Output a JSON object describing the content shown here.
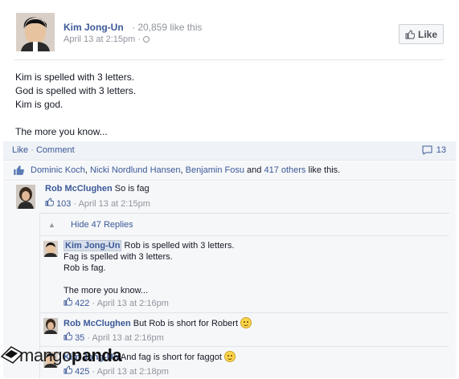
{
  "post": {
    "author": "Kim Jong-Un",
    "likes_text": "· 20,859 like this",
    "timestamp": "April 13 at 2:15pm ·",
    "like_button": "Like",
    "body_lines": [
      "Kim is spelled with 3 letters.",
      "God is spelled with 3 letters.",
      "Kim is god.",
      "",
      "The more you know..."
    ],
    "actions": {
      "like": "Like",
      "sep": "·",
      "comment": "Comment",
      "comment_count": "13"
    },
    "liked_by": {
      "names": [
        "Dominic Koch",
        "Nicki Nordlund Hansen",
        "Benjamin Fosu"
      ],
      "sep1": ", ",
      "and": " and ",
      "others": "417 others",
      "suffix": " like this."
    }
  },
  "comment": {
    "author": "Rob McClughen",
    "text": "So is fag",
    "likes": "103",
    "timestamp": "· April 13 at 2:15pm",
    "hide_replies": "Hide 47 Replies",
    "replies": [
      {
        "author": "Kim Jong-Un",
        "lines": [
          "Rob is spelled with 3 letters.",
          "Fag is spelled with 3 letters.",
          "Rob is fag.",
          "",
          "The more you know..."
        ],
        "likes": "422",
        "timestamp": "· April 13 at 2:16pm"
      },
      {
        "author": "Rob McClughen",
        "text": "But Rob is short for Robert",
        "likes": "35",
        "timestamp": "· April 13 at 2:16pm"
      },
      {
        "author": "Kim Jong-Un",
        "text": "And fag is short for faggot",
        "likes": "425",
        "timestamp": "· April 13 at 2:18pm"
      }
    ]
  },
  "watermark": {
    "prefix": "mango",
    "suffix": "panda"
  }
}
